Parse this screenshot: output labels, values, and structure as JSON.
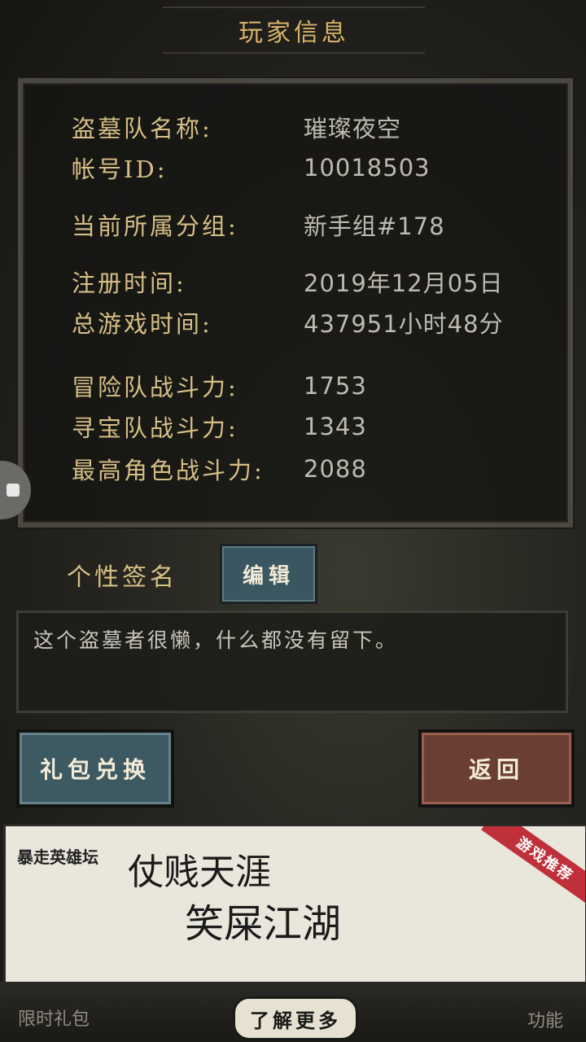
{
  "header": {
    "title": "玩家信息"
  },
  "info": {
    "rows": [
      {
        "label": "盗墓队名称:",
        "value": "璀璨夜空"
      },
      {
        "label": "帐号ID:",
        "value": "10018503"
      },
      {
        "label": "当前所属分组:",
        "value": "新手组#178"
      },
      {
        "label": "注册时间:",
        "value": "2019年12月05日"
      },
      {
        "label": "总游戏时间:",
        "value": "437951小时48分"
      },
      {
        "label": "冒险队战斗力:",
        "value": "1753"
      },
      {
        "label": "寻宝队战斗力:",
        "value": "1343"
      },
      {
        "label": "最高角色战斗力:",
        "value": "2088"
      }
    ]
  },
  "signature": {
    "label": "个性签名",
    "edit_label": "编辑",
    "text": "这个盗墓者很懒，什么都没有留下。"
  },
  "buttons": {
    "gift_exchange": "礼包兑换",
    "back": "返回"
  },
  "ad": {
    "logo": "暴走英雄坛",
    "line1": "仗贱天涯",
    "line2": "笑屎江湖",
    "badge": "游戏推荐"
  },
  "bottom_bar": {
    "left_label": "限时礼包",
    "more_label": "了解更多",
    "right_label": "功能"
  }
}
